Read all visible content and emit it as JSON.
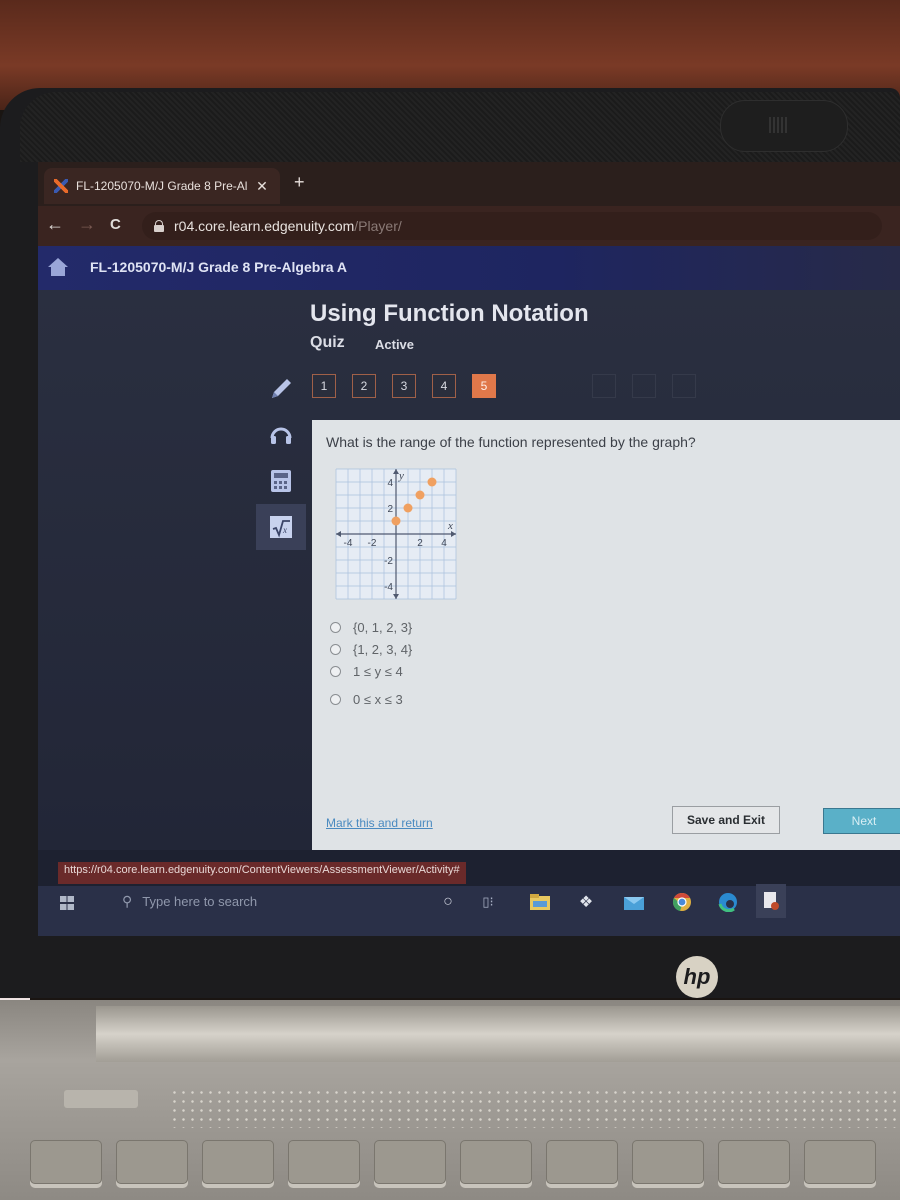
{
  "browser": {
    "tab_title": "FL-1205070-M/J Grade 8 Pre-Al",
    "tab_close": "✕",
    "new_tab": "+",
    "back": "←",
    "forward": "→",
    "reload": "C",
    "url_host": "r04.core.learn.edgenuity.com",
    "url_path": "/Player/",
    "status_url": "https://r04.core.learn.edgenuity.com/ContentViewers/AssessmentViewer/Activity#"
  },
  "app": {
    "course_title": "FL-1205070-M/J Grade 8 Pre-Algebra A",
    "lesson_title": "Using Function Notation",
    "activity_type": "Quiz",
    "activity_status": "Active",
    "question_nav": [
      {
        "label": "1",
        "state": "answered"
      },
      {
        "label": "2",
        "state": "answered"
      },
      {
        "label": "3",
        "state": "answered"
      },
      {
        "label": "4",
        "state": "answered"
      },
      {
        "label": "5",
        "state": "current"
      }
    ],
    "tools": [
      "pencil-icon",
      "headphones-icon",
      "calculator-icon",
      "formula-sqrt-icon"
    ],
    "accent_color": "#e0784a"
  },
  "question": {
    "prompt": "What is the range of the function represented by the graph?",
    "choices": [
      "{0, 1, 2, 3}",
      "{1, 2, 3, 4}",
      "1 ≤ y ≤ 4",
      "0 ≤ x ≤ 3"
    ],
    "mark_link": "Mark this and return",
    "save_exit": "Save and Exit",
    "next": "Next"
  },
  "chart_data": {
    "type": "scatter",
    "title": "",
    "xlabel": "x",
    "ylabel": "y",
    "xlim": [
      -5,
      5
    ],
    "ylim": [
      -5,
      5
    ],
    "x_ticks": [
      "-4",
      "-2",
      "2",
      "4"
    ],
    "y_ticks": [
      "4",
      "2",
      "-2",
      "-4"
    ],
    "grid": true,
    "points": [
      {
        "x": 0,
        "y": 1
      },
      {
        "x": 1,
        "y": 2
      },
      {
        "x": 2,
        "y": 3
      },
      {
        "x": 3,
        "y": 4
      }
    ],
    "point_color": "#f0a060"
  },
  "taskbar": {
    "search_placeholder": "Type here to search",
    "icons": [
      "cortana-icon",
      "task-view-icon",
      "file-explorer-icon",
      "dropbox-icon",
      "mail-icon",
      "chrome-icon",
      "edge-icon",
      "document-app-icon"
    ]
  },
  "laptop": {
    "brand": "hp"
  }
}
